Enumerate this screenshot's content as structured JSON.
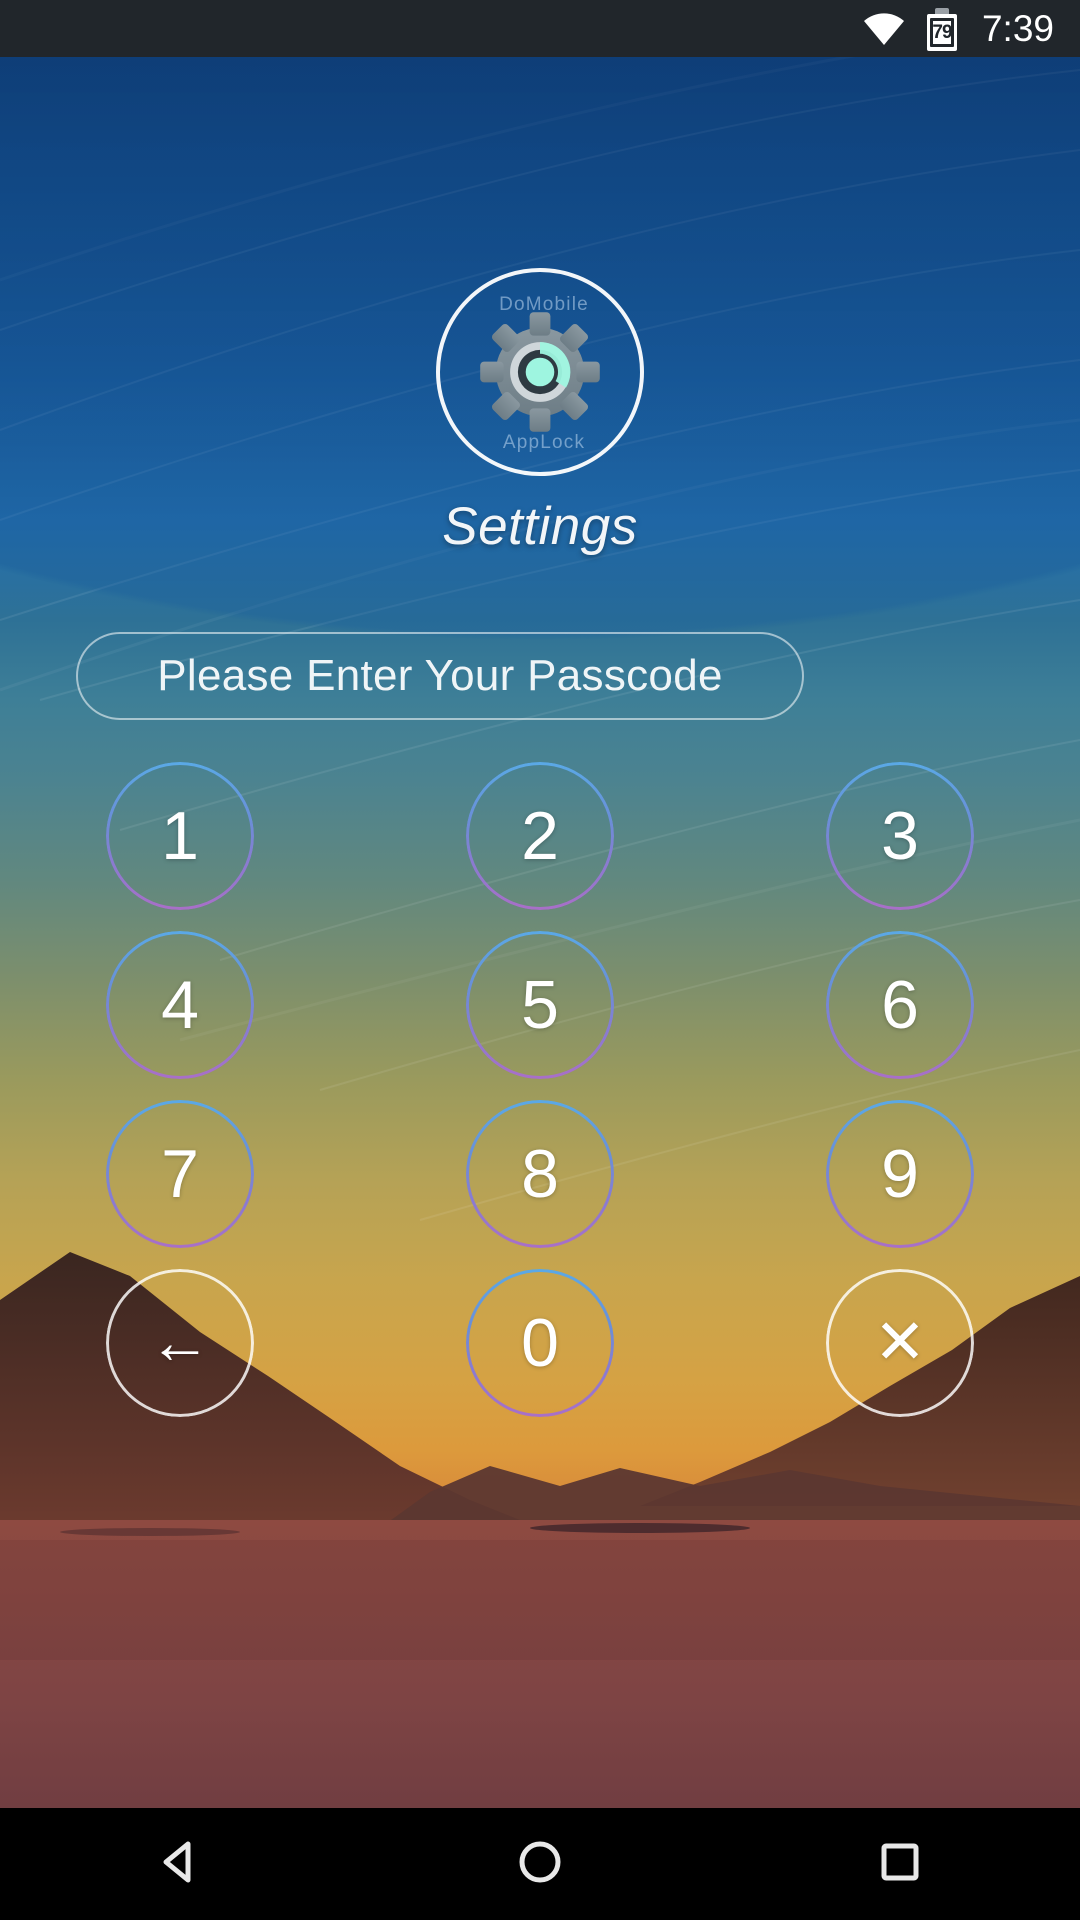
{
  "statusbar": {
    "time": "7:39",
    "battery_level": "79",
    "wifi_icon": "wifi-icon",
    "battery_icon": "battery-icon"
  },
  "app": {
    "icon_name": "applock-gear-icon",
    "ring_label_top": "DoMobile",
    "ring_label_bottom": "AppLock",
    "title": "Settings"
  },
  "passcode": {
    "placeholder": "Please Enter Your Passcode",
    "value": ""
  },
  "keypad": {
    "keys": [
      {
        "label": "1",
        "name": "key-1",
        "style": "gradient"
      },
      {
        "label": "2",
        "name": "key-2",
        "style": "gradient"
      },
      {
        "label": "3",
        "name": "key-3",
        "style": "gradient"
      },
      {
        "label": "4",
        "name": "key-4",
        "style": "gradient"
      },
      {
        "label": "5",
        "name": "key-5",
        "style": "gradient"
      },
      {
        "label": "6",
        "name": "key-6",
        "style": "gradient"
      },
      {
        "label": "7",
        "name": "key-7",
        "style": "gradient"
      },
      {
        "label": "8",
        "name": "key-8",
        "style": "gradient"
      },
      {
        "label": "9",
        "name": "key-9",
        "style": "gradient"
      },
      {
        "label": "←",
        "name": "key-backspace",
        "style": "plain",
        "icon": "back-arrow-icon"
      },
      {
        "label": "0",
        "name": "key-0",
        "style": "gradient"
      },
      {
        "label": "✕",
        "name": "key-clear",
        "style": "plain",
        "icon": "close-x-icon"
      }
    ]
  },
  "navbar": {
    "back_icon": "nav-back-triangle-icon",
    "home_icon": "nav-home-circle-icon",
    "recents_icon": "nav-recents-square-icon"
  },
  "colors": {
    "statusbar_bg": "#21262b",
    "navbar_bg": "#000000",
    "ring_top": "#5aa9e6",
    "ring_bottom": "#a96fc8",
    "gear_accent": "#9ef5e0",
    "sky_top": "#0f3a72",
    "sunset": "#dc9a3c"
  }
}
